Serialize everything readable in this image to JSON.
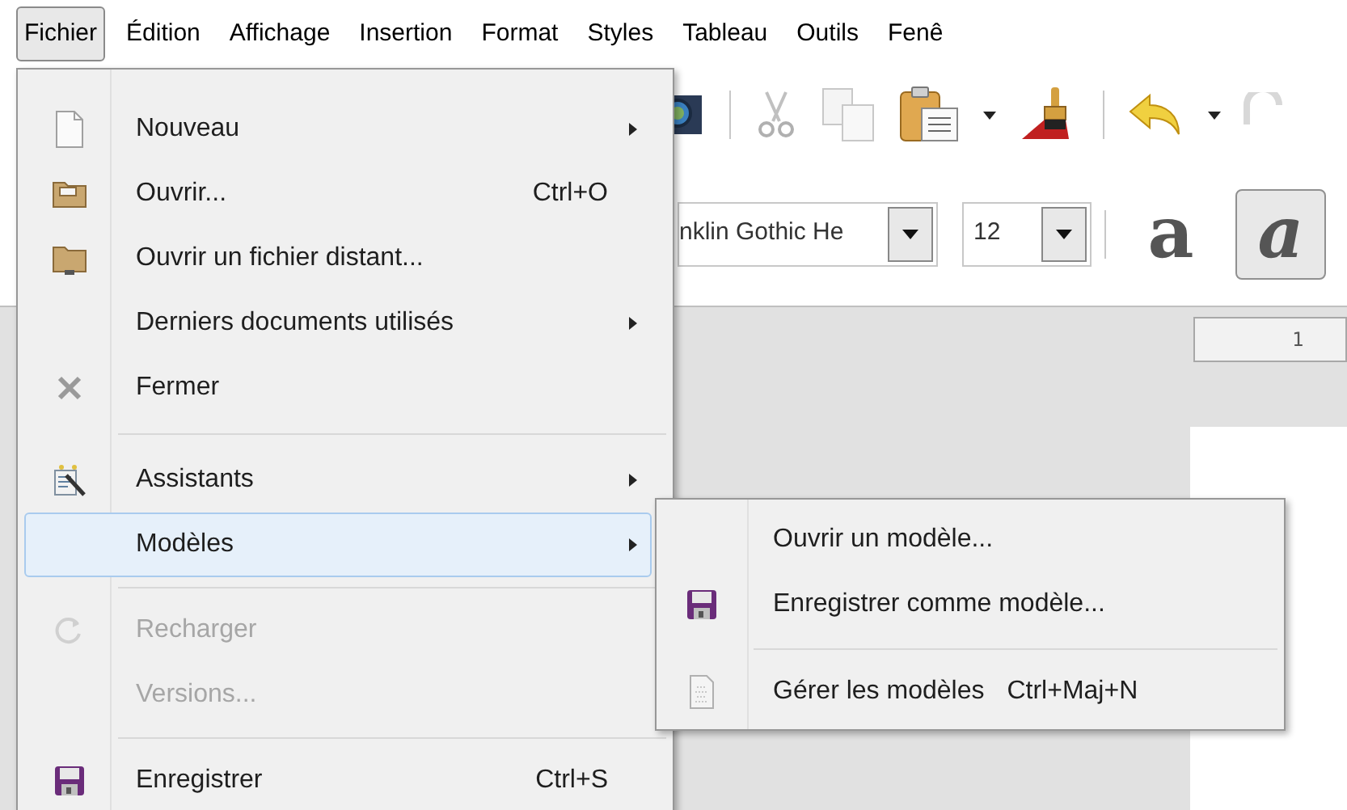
{
  "menubar": [
    {
      "label": "Fichier",
      "selected": true
    },
    {
      "label": "Édition",
      "selected": false
    },
    {
      "label": "Affichage",
      "selected": false
    },
    {
      "label": "Insertion",
      "selected": false
    },
    {
      "label": "Format",
      "selected": false
    },
    {
      "label": "Styles",
      "selected": false
    },
    {
      "label": "Tableau",
      "selected": false
    },
    {
      "label": "Outils",
      "selected": false
    },
    {
      "label": "Fenê",
      "selected": false
    }
  ],
  "toolbar": {
    "font_name": "nklin Gothic He",
    "font_size": "12",
    "format_buttons": [
      {
        "label": "a",
        "selected": false
      },
      {
        "label": "a",
        "selected": true
      }
    ]
  },
  "ruler": {
    "label": "1"
  },
  "menu": [
    {
      "kind": "item",
      "label": "Nouveau",
      "submenu": true,
      "disabled": false,
      "selected": false
    },
    {
      "kind": "item",
      "label": "Ouvrir...",
      "shortcut": "Ctrl+O",
      "submenu": false,
      "disabled": false,
      "selected": false
    },
    {
      "kind": "item",
      "label": "Ouvrir un fichier distant...",
      "submenu": false,
      "disabled": false,
      "selected": false
    },
    {
      "kind": "item",
      "label": "Derniers documents utilisés",
      "submenu": true,
      "disabled": false,
      "selected": false
    },
    {
      "kind": "item",
      "label": "Fermer",
      "submenu": false,
      "disabled": false,
      "selected": false
    },
    {
      "kind": "separator"
    },
    {
      "kind": "item",
      "label": "Assistants",
      "submenu": true,
      "disabled": false,
      "selected": false
    },
    {
      "kind": "item",
      "label": "Modèles",
      "submenu": true,
      "disabled": false,
      "selected": true
    },
    {
      "kind": "separator"
    },
    {
      "kind": "item",
      "label": "Recharger",
      "submenu": false,
      "disabled": true,
      "selected": false
    },
    {
      "kind": "item",
      "label": "Versions...",
      "submenu": false,
      "disabled": true,
      "selected": false
    },
    {
      "kind": "separator"
    },
    {
      "kind": "item",
      "label": "Enregistrer",
      "shortcut": "Ctrl+S",
      "submenu": false,
      "disabled": false,
      "selected": false
    }
  ],
  "submenu": [
    {
      "kind": "item",
      "label": "Ouvrir un modèle..."
    },
    {
      "kind": "item",
      "label": "Enregistrer comme modèle..."
    },
    {
      "kind": "separator"
    },
    {
      "kind": "item",
      "label": "Gérer les modèles",
      "shortcut": "Ctrl+Maj+N"
    }
  ]
}
